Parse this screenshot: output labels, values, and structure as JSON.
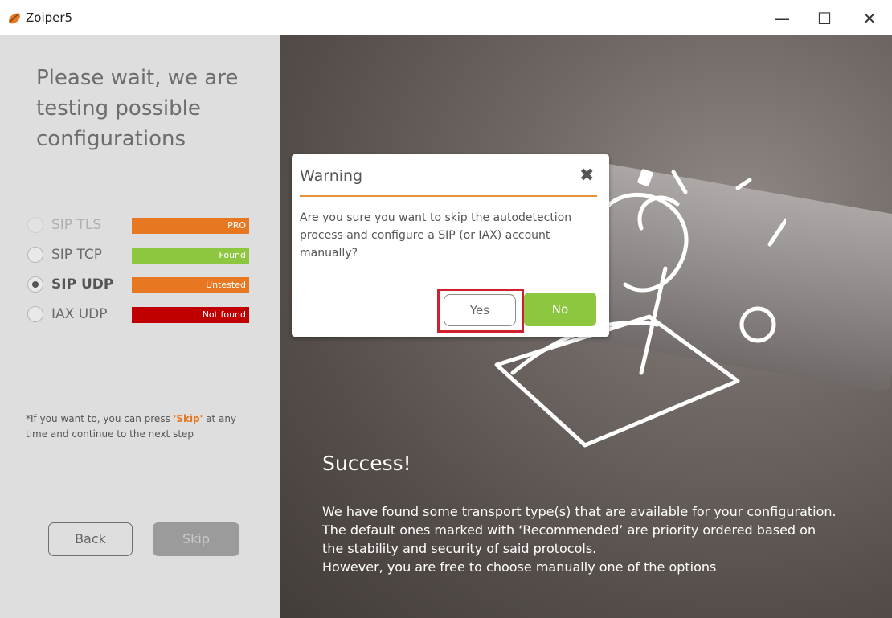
{
  "window": {
    "title": "Zoiper5",
    "minimize_glyph": "—",
    "maximize_glyph": "☐",
    "close_glyph": "✕"
  },
  "left_panel": {
    "title": "Please wait, we are testing possible configurations",
    "protocols": [
      {
        "label": "SIP TLS",
        "badge": "PRO",
        "badge_color": "#e87722",
        "state": "disabled"
      },
      {
        "label": "SIP TCP",
        "badge": "Found",
        "badge_color": "#8dc63f",
        "state": "unchecked"
      },
      {
        "label": "SIP UDP",
        "badge": "Untested",
        "badge_color": "#e87722",
        "state": "checked"
      },
      {
        "label": "IAX UDP",
        "badge": "Not found",
        "badge_color": "#c00000",
        "state": "unchecked"
      }
    ],
    "note_prefix": "*If you want to, you can press ",
    "note_skip": "'Skip'",
    "note_suffix": " at any time and continue to the next step",
    "back_label": "Back",
    "skip_label": "Skip"
  },
  "right_panel": {
    "success_title": "Success!",
    "success_lines": [
      "We have found some transport type(s) that are available for your configuration.",
      "The default ones marked with ‘Recommended’ are priority ordered based on the stability and security of said protocols.",
      "However, you are free to choose manually one of the options"
    ]
  },
  "dialog": {
    "title": "Warning",
    "close_glyph": "✖",
    "message": "Are you sure you want to skip the autodetection process and configure a SIP (or IAX) account manually?",
    "yes_label": "Yes",
    "no_label": "No"
  },
  "colors": {
    "accent_orange": "#e87722",
    "accent_green": "#8dc63f",
    "highlight_red": "#d0202d"
  }
}
